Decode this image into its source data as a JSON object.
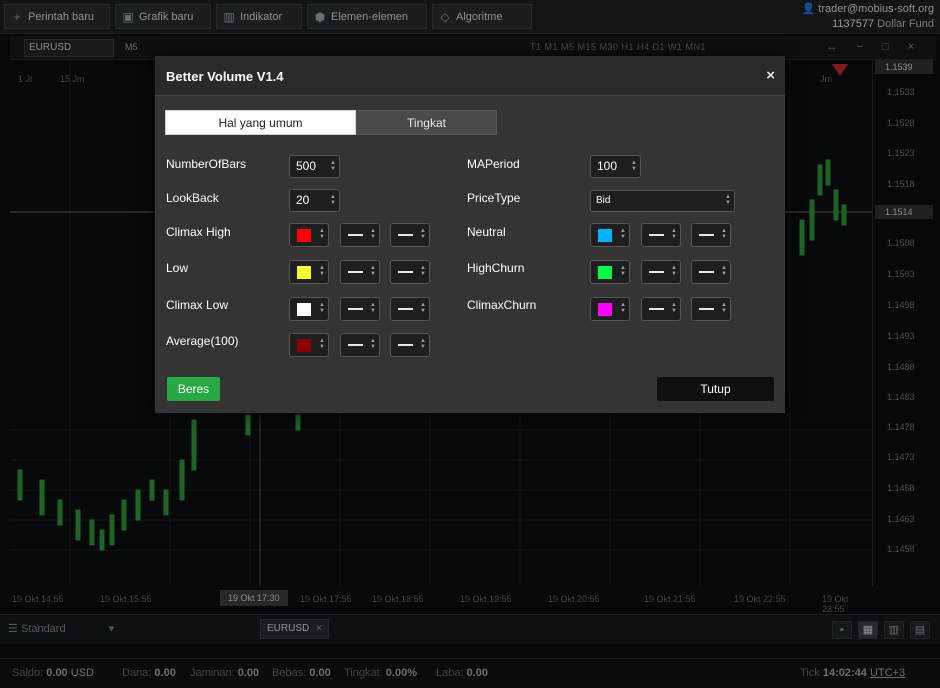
{
  "toolbar": {
    "buttons": [
      {
        "label": "Perintah baru",
        "icon": "plus-icon"
      },
      {
        "label": "Grafik baru",
        "icon": "chart-icon"
      },
      {
        "label": "Indikator",
        "icon": "indicator-icon"
      },
      {
        "label": "Elemen-elemen",
        "icon": "elements-icon"
      },
      {
        "label": "Algoritme",
        "icon": "algorithm-icon"
      }
    ]
  },
  "account": {
    "user": "trader@mobius-soft.org",
    "number": "1137577",
    "fund": "Dollar Fund"
  },
  "chart": {
    "symbol": "EURUSD",
    "timeframe": "M5",
    "timeframes": "T1  M1  M5  M15  M30  H1  H4  D1  W1  MN1",
    "price_ticks": [
      "1.1533",
      "1.1528",
      "1.1523",
      "1.1518",
      "1.1508",
      "1.1503",
      "1.1498",
      "1.1493",
      "1.1488",
      "1.1483",
      "1.1478",
      "1.1473",
      "1.1468",
      "1.1463",
      "1.1458"
    ],
    "price_top": "1.1539",
    "price_current": "1.1514",
    "time_ticks": [
      "19 Okt 14:55",
      "19 Okt 15:55",
      "19 Okt 17:55",
      "19 Okt 18:55",
      "19 Okt 19:55",
      "19 Okt 20:55",
      "19 Okt 21:55",
      "19 Okt 22:55",
      "19 Okt 23:55"
    ],
    "time_cursor": "19 Okt 17:30",
    "header_date": "15 Jm",
    "header_right": "Jm"
  },
  "dialog": {
    "title": "Better Volume V1.4",
    "close_icon": "×",
    "tabs": [
      "Hal yang umum",
      "Tingkat"
    ],
    "left_fields": [
      {
        "label": "NumberOfBars",
        "value": "500"
      },
      {
        "label": "LookBack",
        "value": "20"
      }
    ],
    "left_colors": [
      {
        "label": "Climax High",
        "color": "#ff0000"
      },
      {
        "label": "Low",
        "color": "#ffff33"
      },
      {
        "label": "Climax Low",
        "color": "#ffffff"
      },
      {
        "label": "Average(100)",
        "color": "#8b0000"
      }
    ],
    "right_fields": [
      {
        "label": "MAPeriod",
        "value": "100"
      }
    ],
    "price_type": {
      "label": "PriceType",
      "value": "Bid"
    },
    "right_colors": [
      {
        "label": "Neutral",
        "color": "#00b4ff"
      },
      {
        "label": "HighChurn",
        "color": "#00ff44"
      },
      {
        "label": "ClimaxChurn",
        "color": "#ff00ff"
      }
    ],
    "ok_label": "Beres",
    "close_label": "Tutup"
  },
  "bottom": {
    "layout": "Standard",
    "tab": "EURUSD"
  },
  "status": {
    "saldo_label": "Saldo:",
    "saldo_value": "0.00",
    "saldo_cur": "USD",
    "dana_label": "Dana:",
    "dana_value": "0.00",
    "jaminan_label": "Jaminan:",
    "jaminan_value": "0.00",
    "bebas_label": "Bebas:",
    "bebas_value": "0.00",
    "tingkat_label": "Tingkat:",
    "tingkat_value": "0.00%",
    "laba_label": "Laba:",
    "laba_value": "0.00",
    "tick_label": "Tick",
    "time": "14:02:44",
    "utc": "UTC+3"
  }
}
